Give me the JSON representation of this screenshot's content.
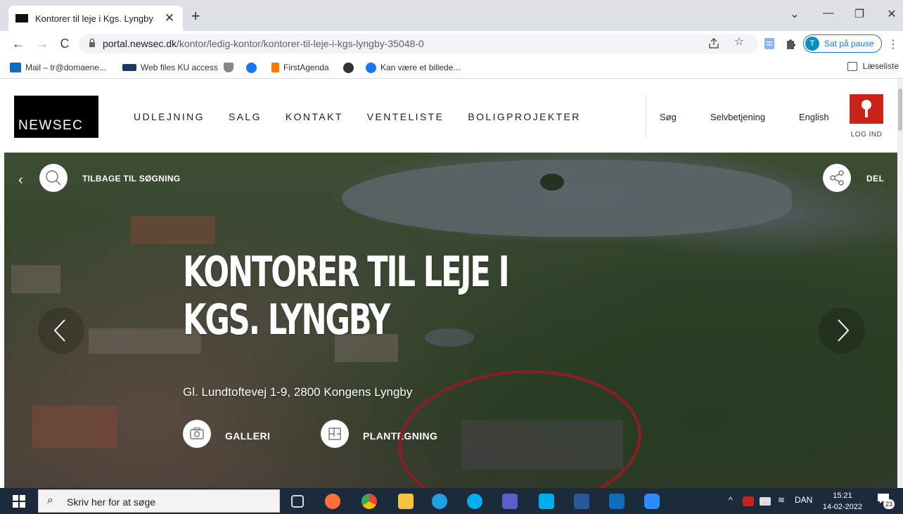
{
  "browser": {
    "tab": {
      "title": "Kontorer til leje i Kgs. Lyngby",
      "close_glyph": "✕"
    },
    "new_tab_glyph": "+",
    "window_controls": {
      "tab_search": "⌄",
      "minimize": "—",
      "restore": "❐",
      "close": "✕"
    },
    "toolbar": {
      "back": "←",
      "forward": "→",
      "reload": "C",
      "url_host": "portal.newsec.dk",
      "url_path": "/kontor/ledig-kontor/kontorer-til-leje-i-kgs-lyngby-35048-0",
      "share_icon": "share-icon",
      "bookmark_star": "☆",
      "profile": {
        "initial": "T",
        "label": "Sat på pause"
      },
      "menu": "⋮"
    },
    "bookmarks": [
      {
        "label": "Mail – tr@domaene...",
        "icon": "outlook-icon",
        "color": "#0f6cbd"
      },
      {
        "label": "Web files KU access",
        "icon": "ku-icon",
        "color": "#1a3a6b"
      },
      {
        "label": "",
        "icon": "crest-icon",
        "color": "#666666"
      },
      {
        "label": "",
        "icon": "facebook-icon",
        "color": "#1877f2"
      },
      {
        "label": "FirstAgenda",
        "icon": "firstagenda-icon",
        "color": "#f57c00"
      },
      {
        "label": "",
        "icon": "github-icon",
        "color": "#333333"
      },
      {
        "label": "Kan være et billede...",
        "icon": "facebook-icon",
        "color": "#1877f2"
      }
    ],
    "reading_list": "Læseliste"
  },
  "site": {
    "logo": "NEWSEC",
    "nav": [
      "UDLEJNING",
      "SALG",
      "KONTAKT",
      "VENTELISTE",
      "BOLIGPROJEKTER"
    ],
    "utility": {
      "search": "Søg",
      "self_service": "Selvbetjening",
      "language": "English"
    },
    "login": "LOG IND",
    "accent_color": "#c9231a"
  },
  "hero": {
    "back_label": "TILBAGE TIL SØGNING",
    "share_label": "DEL",
    "title": "KONTORER TIL LEJE I KGS. LYNGBY",
    "address": "Gl. Lundtoftevej 1-9, 2800 Kongens Lyngby",
    "gallery_label": "GALLERI",
    "floorplan_label": "PLANTEGNING",
    "prev_glyph": "‹",
    "next_glyph": "›",
    "annotation_color": "#8e1c24"
  },
  "taskbar": {
    "search_placeholder": "Skriv her for at søge",
    "apps": [
      {
        "name": "task-view",
        "color": "#cfd8e3"
      },
      {
        "name": "firefox",
        "color": "#ff7139"
      },
      {
        "name": "chrome",
        "color": "#fbbc04"
      },
      {
        "name": "file-explorer",
        "color": "#f5c542"
      },
      {
        "name": "edge",
        "color": "#1fa0e0"
      },
      {
        "name": "skype",
        "color": "#00aff0"
      },
      {
        "name": "teams",
        "color": "#5b5fc7"
      },
      {
        "name": "skype-badge",
        "color": "#00aff0"
      },
      {
        "name": "word",
        "color": "#2b579a"
      },
      {
        "name": "outlook",
        "color": "#0f6cbd"
      },
      {
        "name": "zoom",
        "color": "#2d8cff"
      }
    ],
    "tray_language": "DAN",
    "time": "15:21",
    "date": "14-02-2022",
    "notification_count": "23"
  }
}
